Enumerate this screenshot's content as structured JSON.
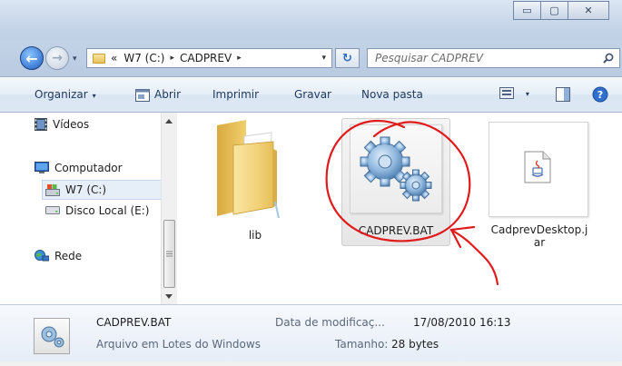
{
  "window": {
    "controls": {
      "minimize": "▭",
      "maximize": "▢",
      "close": "✕"
    }
  },
  "address": {
    "overflow": "«",
    "crumbs": [
      "W7 (C:)",
      "CADPREV"
    ],
    "separator": "▸",
    "dropdown": "▾",
    "refresh": "↻"
  },
  "search": {
    "placeholder": "Pesquisar CADPREV"
  },
  "toolbar": {
    "organize": "Organizar",
    "open": "Abrir",
    "print": "Imprimir",
    "burn": "Gravar",
    "new_folder": "Nova pasta",
    "arrow": "▾"
  },
  "sidebar": {
    "items": [
      {
        "label": "Vídeos",
        "icon": "video-icon"
      },
      {
        "label": "Computador",
        "icon": "computer-icon"
      },
      {
        "label": "W7 (C:)",
        "icon": "drive-icon",
        "selected": true
      },
      {
        "label": "Disco Local (E:)",
        "icon": "disk-icon"
      },
      {
        "label": "Rede",
        "icon": "network-icon"
      }
    ]
  },
  "files": [
    {
      "name": "lib",
      "type": "folder",
      "selected": false
    },
    {
      "name": "CADPREV.BAT",
      "type": "batch",
      "selected": true
    },
    {
      "name_lines": [
        "CadprevDesktop.j",
        "ar"
      ],
      "type": "jar",
      "selected": false
    }
  ],
  "details": {
    "name": "CADPREV.BAT",
    "type": "Arquivo em Lotes do Windows",
    "modified_label": "Data de modificaç...",
    "modified_value": "17/08/2010 16:13",
    "size_label": "Tamanho:",
    "size_value": "28 bytes"
  },
  "colors": {
    "annotation": "#e01b1b",
    "titlebar": "#c9d8ea",
    "toolbar_text": "#1e395b"
  }
}
